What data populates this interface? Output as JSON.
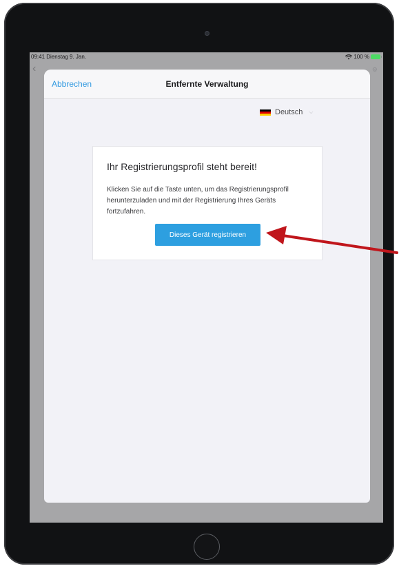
{
  "status_bar": {
    "time_date": "09:41  Dienstag 9. Jan.",
    "battery": "100 %",
    "wifi_icon": "wifi-icon",
    "battery_icon": "battery-icon"
  },
  "navbar": {
    "cancel_label": "Abbrechen",
    "title": "Entfernte Verwaltung"
  },
  "language": {
    "label": "Deutsch",
    "flag_icon": "germany-flag-icon",
    "chevron_icon": "chevron-down-icon"
  },
  "card": {
    "title": "Ihr Registrierungsprofil steht bereit!",
    "text": "Klicken Sie auf die Taste unten, um das Registrierungsprofil herunterzuladen und mit der Registrierung Ihres Geräts fortzufahren.",
    "button_label": "Dieses Gerät registrieren"
  },
  "colors": {
    "accent": "#2d9fe0",
    "link": "#2f98e0",
    "annotation_arrow": "#c0161c"
  }
}
